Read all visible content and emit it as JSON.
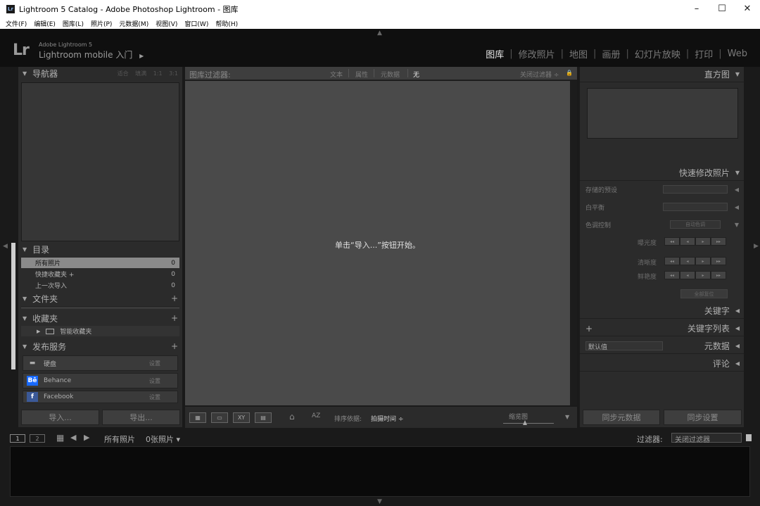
{
  "window": {
    "app_icon": "Lr",
    "title": "Lightroom 5 Catalog - Adobe Photoshop Lightroom - 图库",
    "minimize": "–",
    "maximize": "☐",
    "close": "✕"
  },
  "menu": [
    "文件(F)",
    "编辑(E)",
    "图库(L)",
    "照片(P)",
    "元数据(M)",
    "视图(V)",
    "窗口(W)",
    "帮助(H)"
  ],
  "identity": {
    "logo": "Lr",
    "product": "Adobe Lightroom 5",
    "mobile": "Lightroom mobile 入门",
    "mobile_arrow": "▶"
  },
  "modules": {
    "library": "图库",
    "develop": "修改照片",
    "map": "地图",
    "book": "画册",
    "slideshow": "幻灯片放映",
    "print": "打印",
    "web": "Web",
    "separator": "|"
  },
  "left": {
    "navigator": {
      "title": "导航器",
      "fit": "适合",
      "fill": "填满",
      "one_to_one": "1:1",
      "three_to_one": "3:1"
    },
    "catalog": {
      "title": "目录",
      "rows": [
        {
          "label": "所有照片",
          "count": "0"
        },
        {
          "label": "快捷收藏夹 +",
          "count": "0"
        },
        {
          "label": "上一次导入",
          "count": "0"
        }
      ]
    },
    "folders": {
      "title": "文件夹",
      "plus": "+"
    },
    "collections": {
      "title": "收藏夹",
      "plus": "+",
      "smart": "智能收藏夹"
    },
    "publish": {
      "title": "发布服务",
      "plus": "+",
      "rows": [
        {
          "icon": "▬",
          "label": "硬盘",
          "set": "设置"
        },
        {
          "icon": "Bē",
          "label": "Behance",
          "set": "设置"
        },
        {
          "icon": "f",
          "label": "Facebook",
          "set": "设置"
        }
      ]
    },
    "import_btn": "导入...",
    "export_btn": "导出..."
  },
  "filter": {
    "title": "图库过滤器:",
    "text": "文本",
    "attribute": "属性",
    "metadata": "元数据",
    "none": "无",
    "preset": "关闭过滤器 ÷",
    "lock": "🔒"
  },
  "grid": {
    "hint": "单击“导入...”按钮开始。"
  },
  "toolbar": {
    "sort_label": "排序依据:",
    "sort_value": "拍摄时间 ÷",
    "thumbs_label": "缩览图",
    "grid_icon": "▦",
    "loupe_icon": "▭",
    "compare_icon": "XY",
    "survey_icon": "▤",
    "spray_icon": "⌂",
    "az_icon": "AZ",
    "chevron": "▼"
  },
  "right": {
    "histogram": {
      "title": "直方图"
    },
    "quick_develop": {
      "title": "快速修改照片",
      "saved_preset": "存储的预设",
      "white_balance": "白平衡",
      "tone_control": "色调控制",
      "exposure": "曝光度",
      "clarity": "清晰度",
      "vibrance": "鲜艳度",
      "auto_tone": "自动色调",
      "reset": "全部复位",
      "step_buttons": [
        "◂◂",
        "◂",
        "▸",
        "▸▸"
      ]
    },
    "keywording": {
      "title": "关键字"
    },
    "keyword_list": {
      "title": "关键字列表",
      "plus": "+"
    },
    "metadata": {
      "title": "元数据",
      "preset": "默认值"
    },
    "comments": {
      "title": "评论"
    },
    "sync_metadata_btn": "同步元数据",
    "sync_settings_btn": "同步设置"
  },
  "filmstrip": {
    "screen1": "1",
    "screen2": "2",
    "source": "所有照片",
    "count": "0张照片 ▾",
    "filter_label": "过滤器:",
    "filter_value": "关闭过滤器"
  }
}
